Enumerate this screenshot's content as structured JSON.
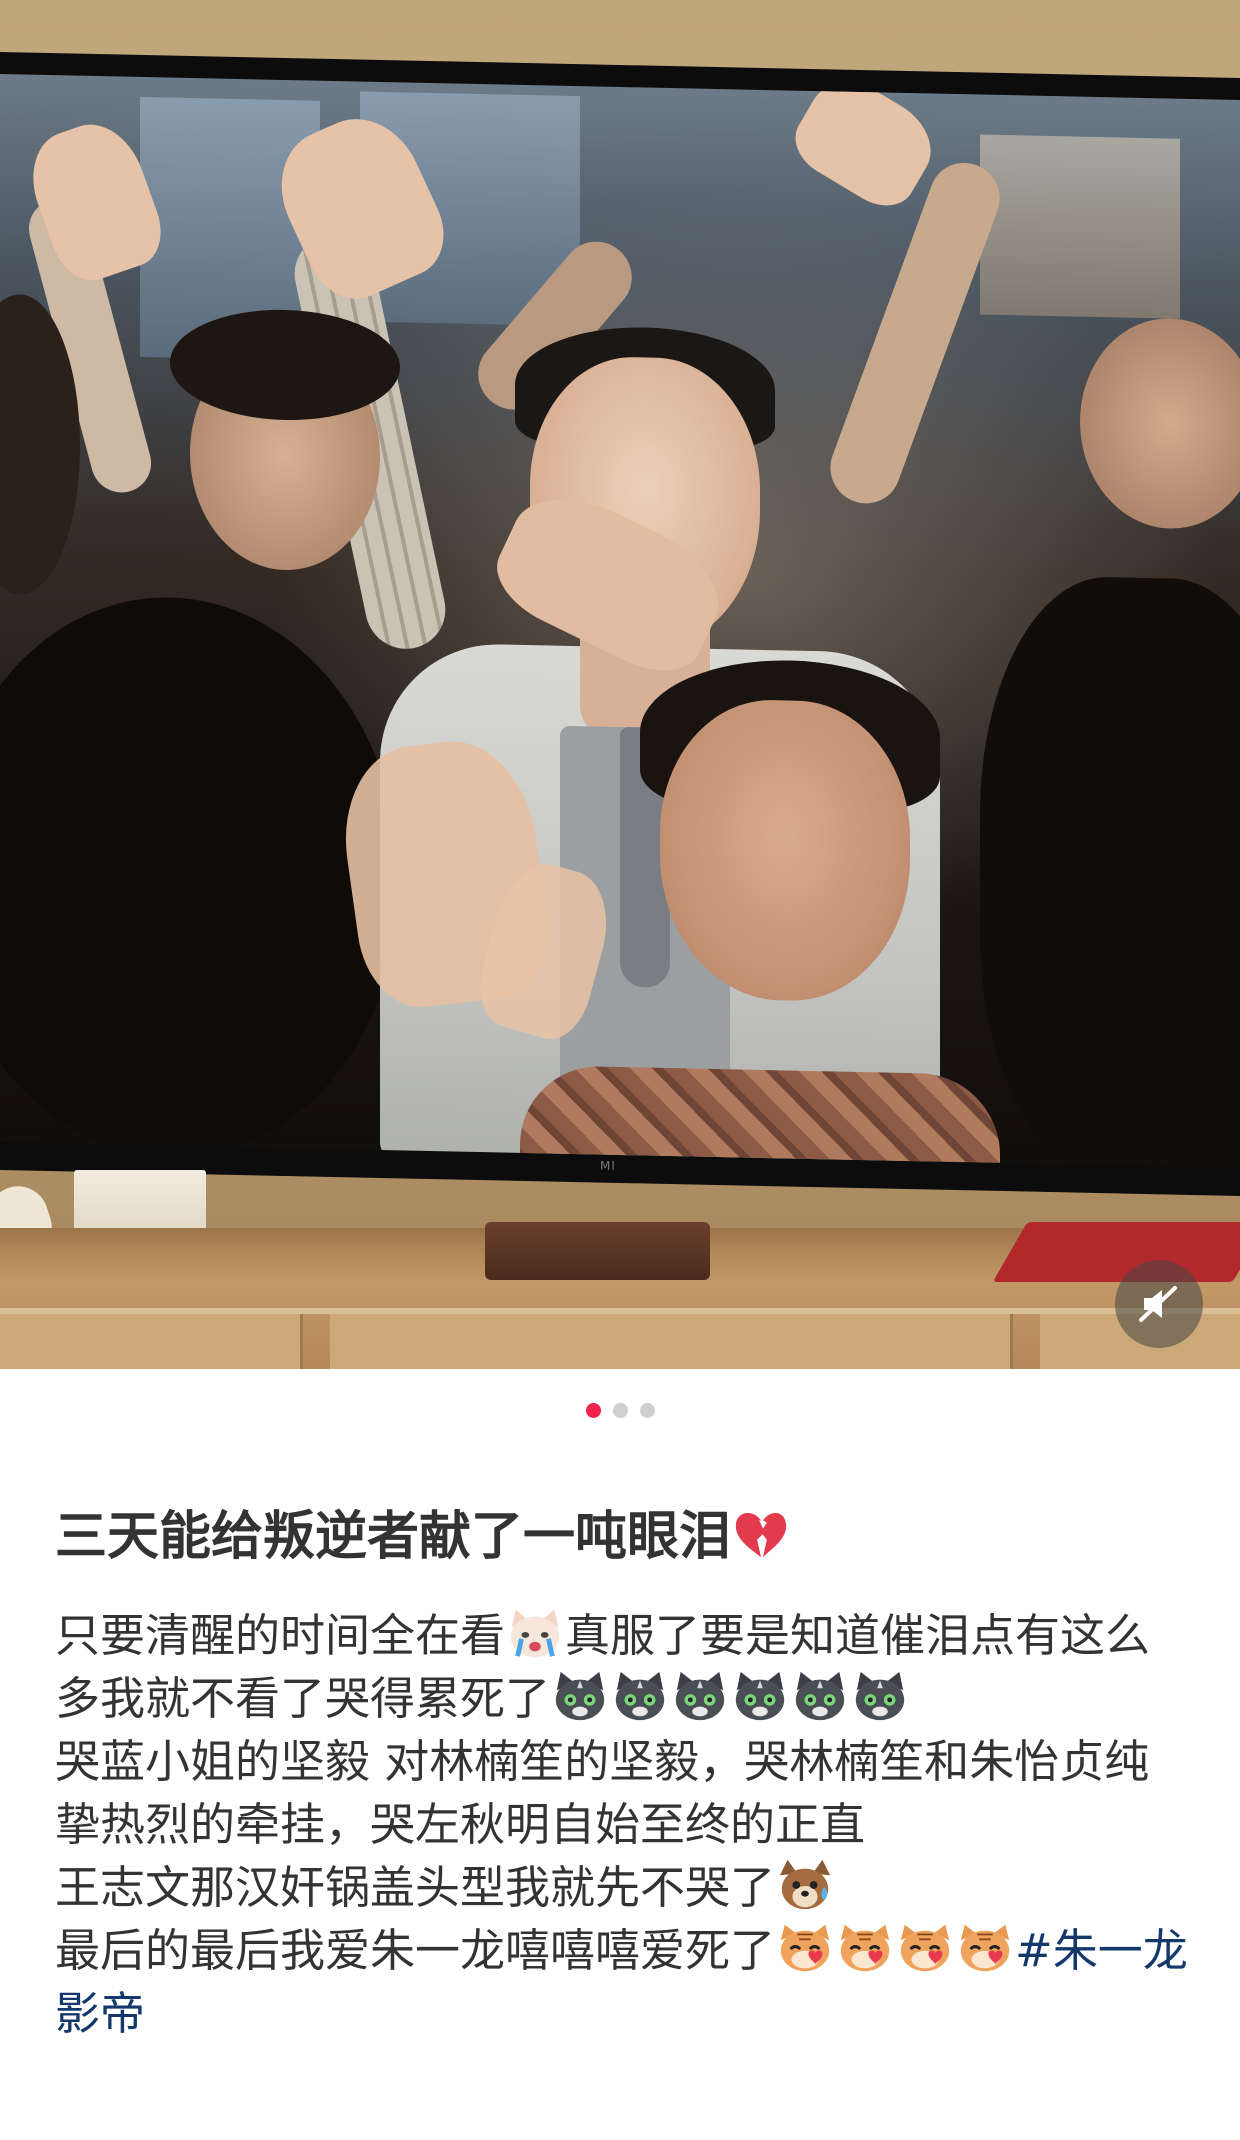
{
  "pagination": {
    "total": 3,
    "active_index": 0
  },
  "colors": {
    "dot_active": "#f2234a",
    "dot_inactive": "#cfcfcf",
    "text": "#333333",
    "hashtag": "#14386b"
  },
  "tv": {
    "brand_logo": "MI"
  },
  "mute_button": {
    "icon": "speaker-muted-icon"
  },
  "post": {
    "title": "三天能给叛逆者献了一吨眼泪",
    "title_emoji": "broken-heart-icon",
    "line1_text_a": "只要清醒的时间全在看",
    "line1_emoji": "crying-cat-icon",
    "line1_text_b": "真服了要是知道催泪点有这么多我就不看了哭得累死了",
    "line1_trailing_emojis": [
      "cat-face-icon",
      "cat-face-icon",
      "cat-face-icon",
      "cat-face-icon",
      "cat-face-icon",
      "cat-face-icon"
    ],
    "line2_text": "哭蓝小姐的坚毅 对林楠笙的坚毅，哭林楠笙和朱怡贞纯挚热烈的牵挂，哭左秋明自始至终的正直",
    "line3_text": "王志文那汉奸锅盖头型我就先不哭了",
    "line3_emoji": "sweating-dog-icon",
    "line4_text": "最后的最后我爱朱一龙嘻嘻嘻爱死了",
    "line4_emojis": [
      "heart-tiger-icon",
      "heart-tiger-icon",
      "heart-tiger-icon",
      "heart-tiger-icon"
    ],
    "hashtag": "#朱一龙影帝"
  }
}
